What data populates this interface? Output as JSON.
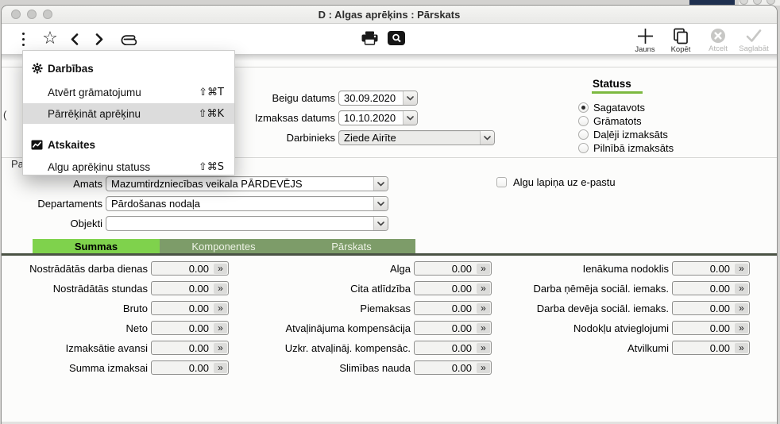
{
  "window": {
    "title": "D : Algas aprēķins : Pārskats"
  },
  "toolbar": {
    "left_icons": [
      "kebab-menu",
      "star",
      "back",
      "forward",
      "paperclip"
    ],
    "center_icons": [
      "print",
      "search"
    ],
    "buttons": [
      {
        "label": "Jauns",
        "icon": "plus",
        "enabled": true
      },
      {
        "label": "Kopēt",
        "icon": "copy",
        "enabled": true
      },
      {
        "label": "Atcelt",
        "icon": "cancel-circle",
        "enabled": false
      },
      {
        "label": "Saglabāt",
        "icon": "checkmark",
        "enabled": false
      }
    ]
  },
  "menu": {
    "sections": [
      {
        "header": "Darbības",
        "icon": "gear-icon",
        "items": [
          {
            "label": "Atvērt grāmatojumu",
            "shortcut": "⇧⌘T",
            "highlighted": false
          },
          {
            "label": "Pārrēķināt aprēķinu",
            "shortcut": "⇧⌘K",
            "highlighted": true
          }
        ]
      },
      {
        "header": "Atskaites",
        "icon": "chart-icon",
        "items": [
          {
            "label": "Algu aprēķinu statuss",
            "shortcut": "⇧⌘S",
            "highlighted": false
          }
        ]
      }
    ]
  },
  "header_form": {
    "fields": [
      {
        "label": "Beigu datums",
        "value": "30.09.2020"
      },
      {
        "label": "Izmaksas datums",
        "value": "10.10.2020"
      },
      {
        "label": "Darbinieks",
        "value": "Ziede Airīte"
      }
    ],
    "status": {
      "title": "Statuss",
      "options": [
        {
          "label": "Sagatavots",
          "selected": true
        },
        {
          "label": "Grāmatots",
          "selected": false
        },
        {
          "label": "Daļēji izmaksāts",
          "selected": false
        },
        {
          "label": "Pilnībā izmaksāts",
          "selected": false
        }
      ]
    }
  },
  "edge_fragments": {
    "paren": "(",
    "partial_label": "Pa"
  },
  "detail_form": {
    "fields": [
      {
        "label": "Amats",
        "value": "Mazumtirdzniecības veikala PĀRDEVĒJS"
      },
      {
        "label": "Departaments",
        "value": "Pārdošanas nodaļa"
      },
      {
        "label": "Objekti",
        "value": ""
      }
    ],
    "checkbox": {
      "label": "Algu lapiņa uz e-pastu",
      "checked": false
    }
  },
  "tabs": [
    {
      "label": "Summas",
      "active": true
    },
    {
      "label": "Komponentes",
      "active": false
    },
    {
      "label": "Pārskats",
      "active": false
    }
  ],
  "summary": {
    "col1": [
      {
        "label": "Nostrādātās darba dienas",
        "value": "0.00"
      },
      {
        "label": "Nostrādātās stundas",
        "value": "0.00"
      },
      {
        "label": "Bruto",
        "value": "0.00"
      },
      {
        "label": "Neto",
        "value": "0.00"
      },
      {
        "label": "Izmaksātie avansi",
        "value": "0.00"
      },
      {
        "label": "Summa izmaksai",
        "value": "0.00"
      }
    ],
    "col2": [
      {
        "label": "Alga",
        "value": "0.00"
      },
      {
        "label": "Cita atlīdzība",
        "value": "0.00"
      },
      {
        "label": "Piemaksas",
        "value": "0.00"
      },
      {
        "label": "Atvaļinājuma kompensācija",
        "value": "0.00"
      },
      {
        "label": "Uzkr. atvaļināj. kompensāc.",
        "value": "0.00"
      },
      {
        "label": "Slimības nauda",
        "value": "0.00"
      }
    ],
    "col3": [
      {
        "label": "Ienākuma nodoklis",
        "value": "0.00"
      },
      {
        "label": "Darba ņēmēja sociāl. iemaks.",
        "value": "0.00"
      },
      {
        "label": "Darba devēja sociāl. iemaks.",
        "value": "0.00"
      },
      {
        "label": "Nodokļu atvieglojumi",
        "value": "0.00"
      },
      {
        "label": "Atvilkumi",
        "value": "0.00"
      }
    ],
    "expand_glyph": "»"
  },
  "colors": {
    "active_tab": "#7fd24c",
    "inactive_tab": "#7d9c69",
    "tab_underline": "#4a5244",
    "status_underline": "#7cb940",
    "menu_highlight": "#dcdcdc"
  }
}
